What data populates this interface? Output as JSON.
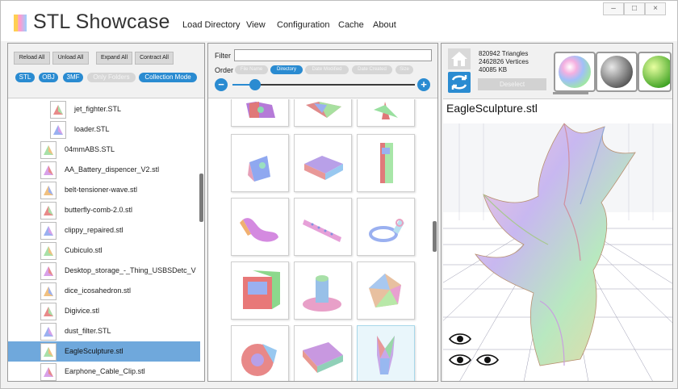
{
  "app": {
    "title": "STL Showcase"
  },
  "menu": [
    {
      "label": "Load Directory"
    },
    {
      "label": "View"
    },
    {
      "label": "Configuration"
    },
    {
      "label": "Cache"
    },
    {
      "label": "About"
    }
  ],
  "window_controls": {
    "minimize": "–",
    "maximize": "□",
    "close": "×"
  },
  "left": {
    "buttons": {
      "reload_all": "Reload All",
      "unload_all": "Unload All",
      "expand_all": "Expand All",
      "contract_all": "Contract All"
    },
    "filters": [
      {
        "label": "STL",
        "active": true
      },
      {
        "label": "OBJ",
        "active": true
      },
      {
        "label": "3MF",
        "active": true
      },
      {
        "label": "Only Folders",
        "active": false
      },
      {
        "label": "Collection Mode",
        "active": true
      }
    ],
    "files": [
      {
        "label": "jet_fighter.STL",
        "indent": 2,
        "selected": false
      },
      {
        "label": "loader.STL",
        "indent": 2,
        "selected": false
      },
      {
        "label": "04mmABS.STL",
        "indent": 1,
        "selected": false
      },
      {
        "label": "AA_Battery_dispencer_V2.stl",
        "indent": 1,
        "selected": false
      },
      {
        "label": "belt-tensioner-wave.stl",
        "indent": 1,
        "selected": false
      },
      {
        "label": "butterfly-comb-2.0.stl",
        "indent": 1,
        "selected": false
      },
      {
        "label": "clippy_repaired.stl",
        "indent": 1,
        "selected": false
      },
      {
        "label": "Cubiculo.stl",
        "indent": 1,
        "selected": false
      },
      {
        "label": "Desktop_storage_-_Thing_USBSDetc_V",
        "indent": 1,
        "selected": false
      },
      {
        "label": "dice_icosahedron.stl",
        "indent": 1,
        "selected": false
      },
      {
        "label": "Digivice.stl",
        "indent": 1,
        "selected": false
      },
      {
        "label": "dust_filter.STL",
        "indent": 1,
        "selected": false
      },
      {
        "label": "EagleSculpture.stl",
        "indent": 1,
        "selected": true
      },
      {
        "label": "Earphone_Cable_Clip.stl",
        "indent": 1,
        "selected": false
      }
    ]
  },
  "middle": {
    "filter_label": "Filter",
    "filter_value": "",
    "order_label": "Order",
    "order_options": [
      {
        "label": "File Name",
        "active": false
      },
      {
        "label": "Directory",
        "active": true
      },
      {
        "label": "Date Modified",
        "active": false
      },
      {
        "label": "Date Created",
        "active": false
      },
      {
        "label": "Size",
        "active": false
      }
    ],
    "zoom_out": "−",
    "zoom_in": "+",
    "zoom_level": 0.13
  },
  "right": {
    "triangles": "820942 Triangles",
    "vertices": "2462826 Vertices",
    "size": "40085 KB",
    "deselect": "Deselect",
    "model_name": "EagleSculpture.stl",
    "materials": [
      "rainbow-sphere",
      "grey-sphere",
      "green-sphere"
    ]
  },
  "colors": {
    "accent": "#2a8bd1",
    "selection": "#6fa8dc"
  }
}
